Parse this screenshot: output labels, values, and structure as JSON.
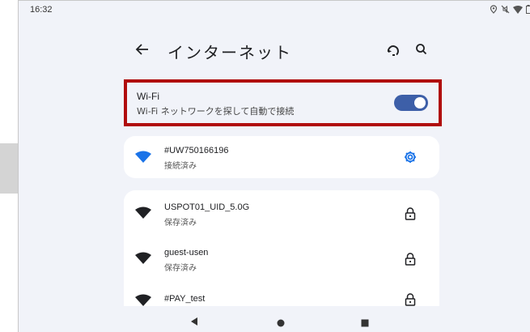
{
  "status_bar": {
    "time": "16:32",
    "icons": [
      "location-icon",
      "mute-icon",
      "wifi-signal-icon",
      "battery-icon"
    ]
  },
  "header": {
    "title": "インターネット",
    "back_icon": "arrow-left-icon",
    "refresh_icon": "refresh-icon",
    "search_icon": "search-icon"
  },
  "wifi": {
    "label": "Wi-Fi",
    "description": "Wi-Fi ネットワークを探して自動で接続",
    "enabled": true,
    "highlight_color": "#b00d0d",
    "accent_color": "#3d5fa8"
  },
  "connected_network": {
    "ssid": "#UW750166196",
    "status": "接続済み",
    "action_icon": "gear-icon"
  },
  "saved_networks": [
    {
      "ssid": "USPOT01_UID_5.0G",
      "status": "保存済み",
      "action_icon": "lock-icon"
    },
    {
      "ssid": "guest-usen",
      "status": "保存済み",
      "action_icon": "lock-icon"
    },
    {
      "ssid": "#PAY_test",
      "status": "",
      "action_icon": "lock-icon"
    }
  ],
  "nav_bar": {
    "buttons": [
      "back-triangle-icon",
      "home-circle-icon",
      "recents-square-icon"
    ]
  }
}
